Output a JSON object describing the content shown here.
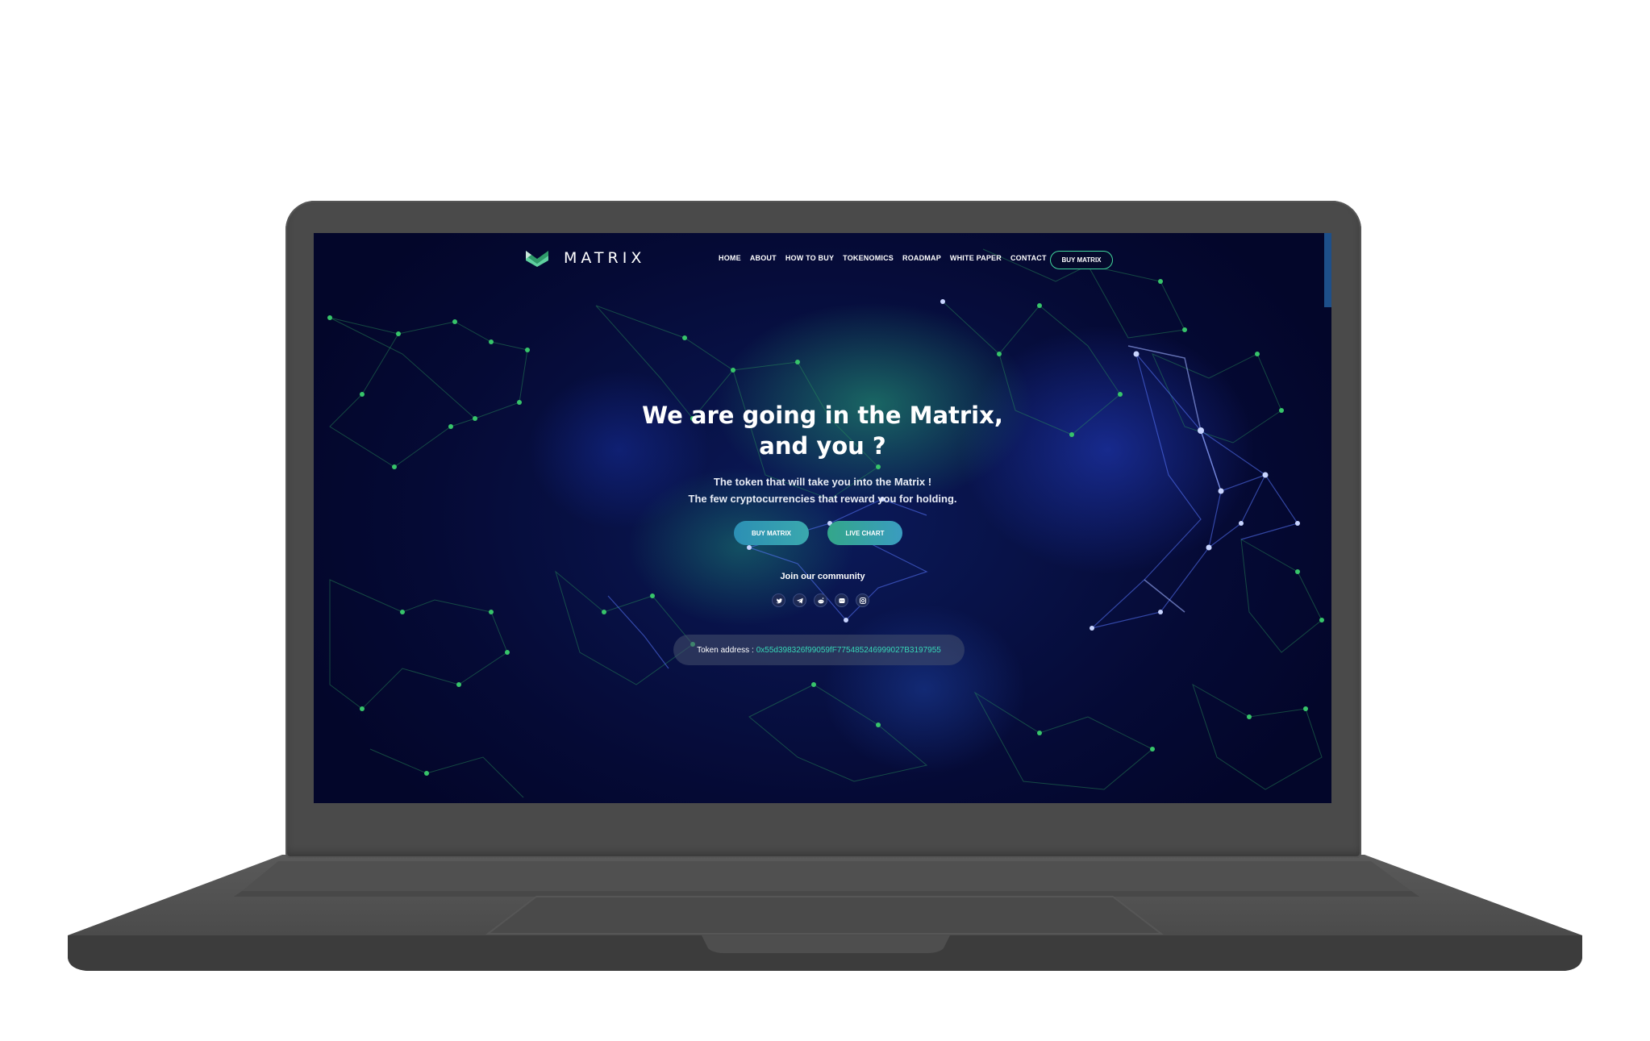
{
  "nav": {
    "logo_text": "MATRIX",
    "items": [
      {
        "label": "HOME"
      },
      {
        "label": "ABOUT"
      },
      {
        "label": "HOW TO BUY"
      },
      {
        "label": "TOKENOMICS"
      },
      {
        "label": "ROADMAP"
      },
      {
        "label": "WHITE PAPER"
      },
      {
        "label": "CONTACT"
      }
    ],
    "cta_label": "BUY MATRIX"
  },
  "hero": {
    "title_line1": "We are going in the Matrix,",
    "title_line2": "and you ?",
    "subtitle_line1": "The token that will take you into the Matrix !",
    "subtitle_line2": "The few cryptocurrencies that reward you for holding.",
    "buy_label": "BUY MATRIX",
    "chart_label": "LIVE CHART"
  },
  "community": {
    "label": "Join our community",
    "socials": [
      "twitter-icon",
      "telegram-icon",
      "reddit-icon",
      "discord-icon",
      "instagram-icon"
    ]
  },
  "token": {
    "label": "Token address :",
    "address": "0x55d398326f99059fF775485246999027B3197955"
  },
  "colors": {
    "accent_green": "#41d69c",
    "address_teal": "#36d6b7",
    "bg_deep": "#050a35",
    "laptop_body": "#4a4a4a"
  }
}
